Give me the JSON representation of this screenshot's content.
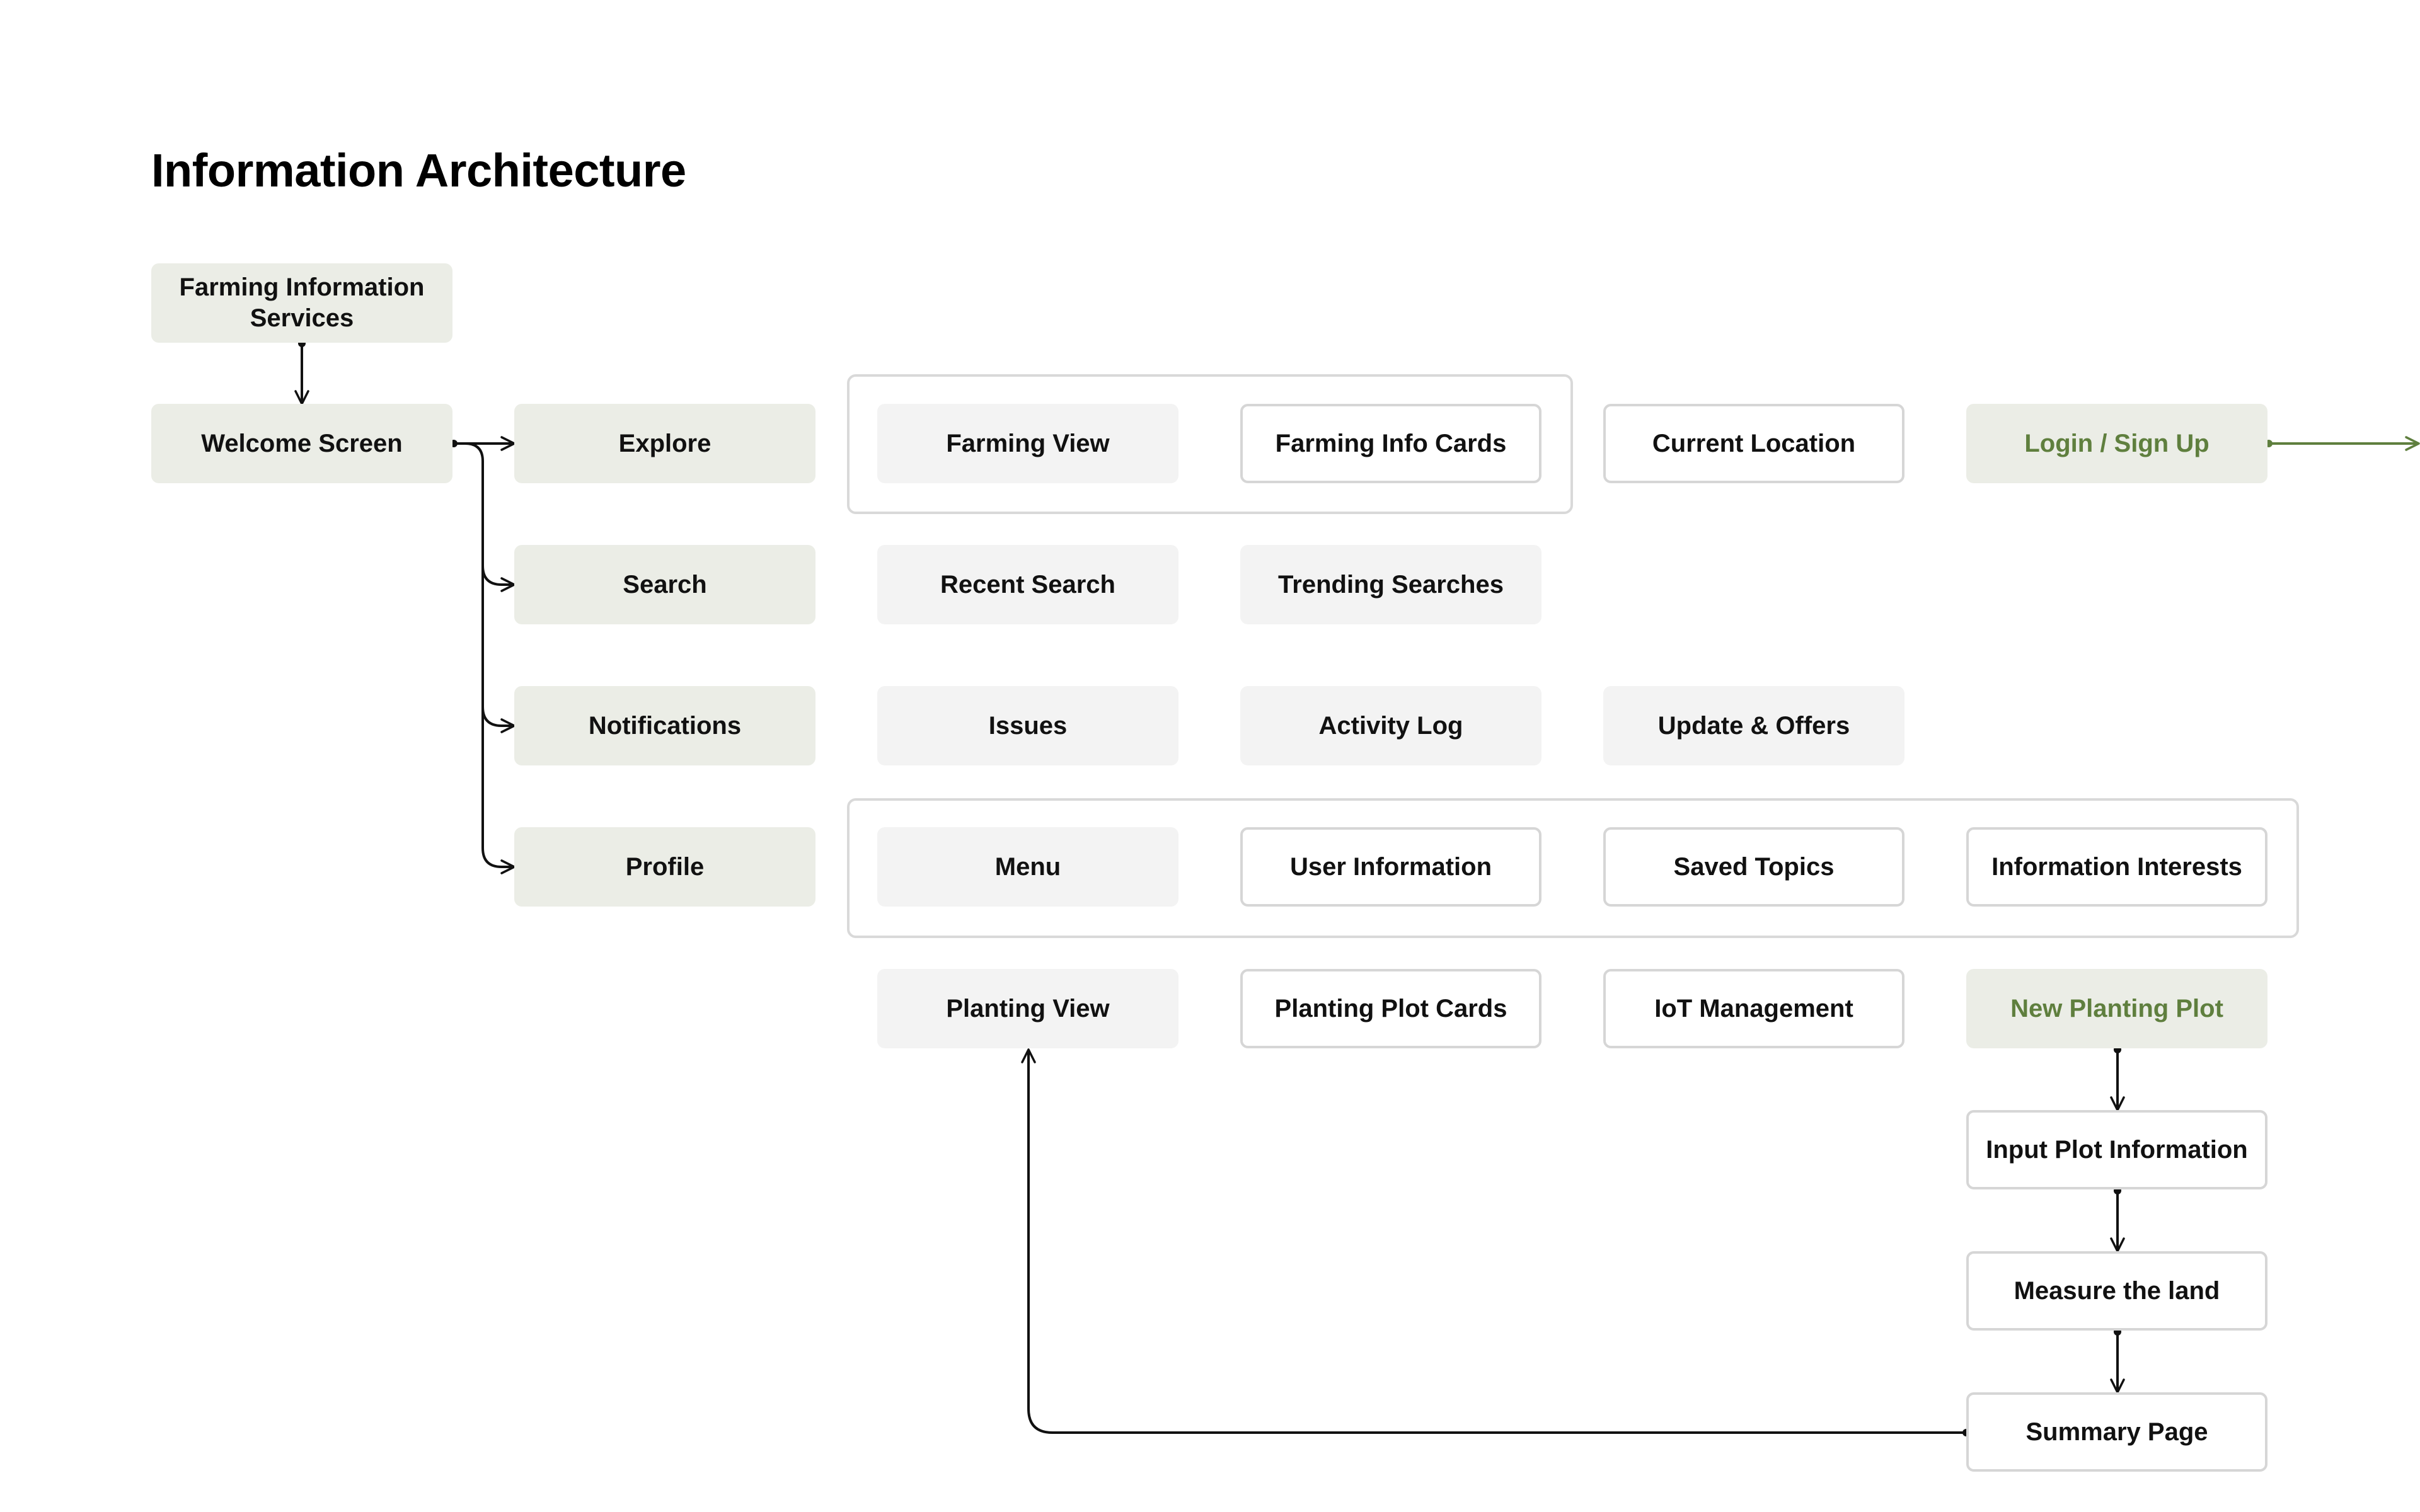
{
  "title": "Information Architecture",
  "colors": {
    "primary_fill": "#ebede6",
    "muted_fill": "#f3f3f3",
    "outline_border": "#d6d6d6",
    "accent_text": "#5f7f3e",
    "connector": "#111111"
  },
  "nodes": {
    "farming_information_services": "Farming Information Services",
    "welcome_screen": "Welcome Screen",
    "explore": "Explore",
    "search": "Search",
    "notifications": "Notifications",
    "profile": "Profile",
    "farming_view": "Farming View",
    "farming_info_cards": "Farming Info Cards",
    "current_location": "Current Location",
    "login_sign_up": "Login / Sign Up",
    "recent_search": "Recent Search",
    "trending_searches": "Trending Searches",
    "issues": "Issues",
    "activity_log": "Activity Log",
    "update_offers": "Update & Offers",
    "menu": "Menu",
    "user_information": "User Information",
    "saved_topics": "Saved Topics",
    "information_interests": "Information Interests",
    "planting_view": "Planting View",
    "planting_plot_cards": "Planting Plot Cards",
    "iot_management": "IoT Management",
    "new_planting_plot": "New Planting Plot",
    "input_plot_information": "Input Plot Information",
    "measure_the_land": "Measure the land",
    "summary_page": "Summary Page"
  },
  "connections": [
    {
      "from": "Farming Information Services",
      "to": "Welcome Screen"
    },
    {
      "from": "Welcome Screen",
      "to": "Explore"
    },
    {
      "from": "Welcome Screen",
      "to": "Search"
    },
    {
      "from": "Welcome Screen",
      "to": "Notifications"
    },
    {
      "from": "Welcome Screen",
      "to": "Profile"
    },
    {
      "from": "New Planting Plot",
      "to": "Input Plot Information"
    },
    {
      "from": "Input Plot Information",
      "to": "Measure the land"
    },
    {
      "from": "Measure the land",
      "to": "Summary Page"
    },
    {
      "from": "Summary Page",
      "to": "Planting View"
    },
    {
      "from": "Login / Sign Up",
      "to": ""
    }
  ]
}
